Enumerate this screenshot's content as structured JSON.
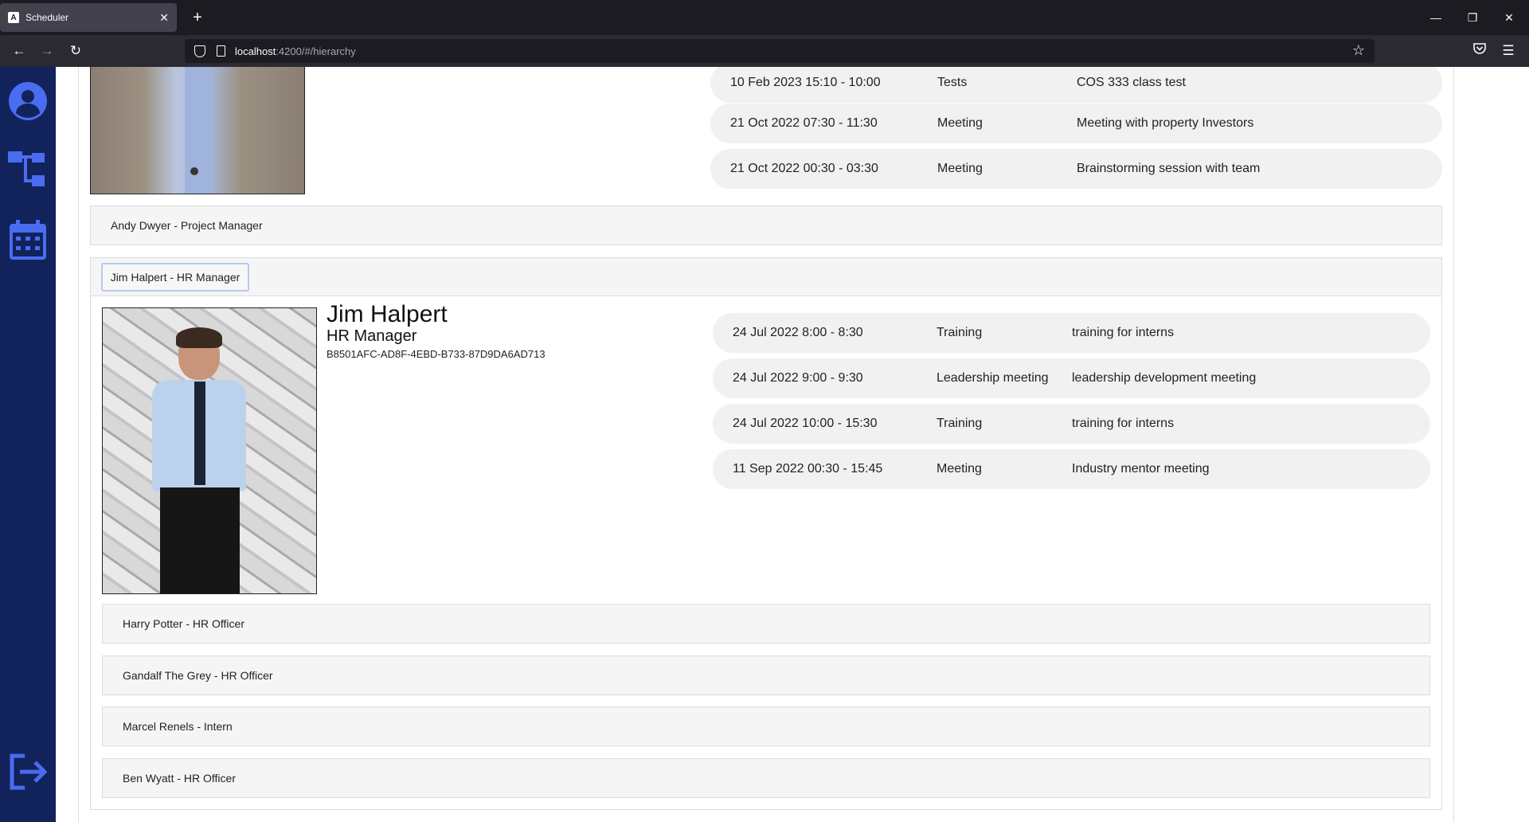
{
  "browser": {
    "tab_title": "Scheduler",
    "url_host": "localhost",
    "url_path": ":4200/#/hierarchy"
  },
  "sidebar": {
    "items": [
      {
        "icon": "user-circle-icon"
      },
      {
        "icon": "hierarchy-icon"
      },
      {
        "icon": "calendar-icon"
      },
      {
        "icon": "logout-icon"
      }
    ]
  },
  "top_section": {
    "events": [
      {
        "date": "10 Feb 2023 15:10 - 10:00",
        "type": "Tests",
        "description": "COS 333 class test"
      },
      {
        "date": "21 Oct 2022 07:30 - 11:30",
        "type": "Meeting",
        "description": "Meeting with property Investors"
      },
      {
        "date": "21 Oct 2022 00:30 - 03:30",
        "type": "Meeting",
        "description": "Brainstorming session with team"
      }
    ]
  },
  "andy_row": {
    "label": "Andy Dwyer - Project Manager"
  },
  "jim": {
    "tab_label": "Jim Halpert - HR Manager",
    "name": "Jim Halpert",
    "role": "HR Manager",
    "id": "B8501AFC-AD8F-4EBD-B733-87D9DA6AD713",
    "events": [
      {
        "date": "24 Jul 2022 8:00 - 8:30",
        "type": "Training",
        "description": "training for interns"
      },
      {
        "date": "24 Jul 2022 9:00 - 9:30",
        "type": "Leadership meeting",
        "description": "leadership development meeting"
      },
      {
        "date": "24 Jul 2022 10:00 - 15:30",
        "type": "Training",
        "description": "training for interns"
      },
      {
        "date": "11 Sep 2022 00:30 - 15:45",
        "type": "Meeting",
        "description": "Industry mentor meeting"
      }
    ],
    "subordinates": [
      {
        "label": "Harry Potter - HR Officer"
      },
      {
        "label": "Gandalf The Grey - HR Officer"
      },
      {
        "label": "Marcel Renels - Intern"
      },
      {
        "label": "Ben Wyatt - HR Officer"
      }
    ]
  },
  "colors": {
    "sidebar_bg": "#11235a",
    "icon_color": "#4a6cf0",
    "row_bg": "#f1f1f1"
  }
}
